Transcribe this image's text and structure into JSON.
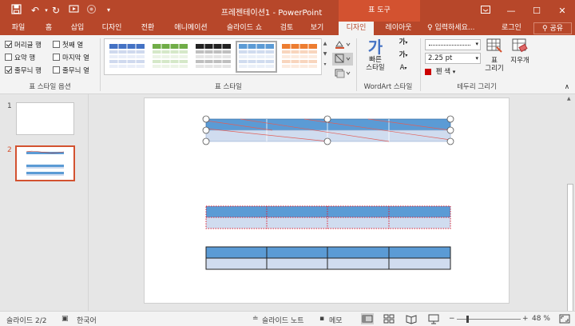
{
  "titlebar": {
    "title": "프레젠테이션1 - PowerPoint",
    "context_tab": "표 도구",
    "quick_access": [
      "save-icon",
      "undo-icon",
      "redo-icon",
      "start-from-beginning-icon",
      "touch-mode-icon"
    ],
    "window_buttons": [
      "ribbon-display-icon",
      "minimize-icon",
      "maximize-icon",
      "close-icon"
    ]
  },
  "tabs": [
    "파일",
    "홈",
    "삽입",
    "디자인",
    "전환",
    "애니메이션",
    "슬라이드 쇼",
    "검토",
    "보기",
    "디자인",
    "레이아웃"
  ],
  "active_tab_index": 9,
  "tellme": "입력하세요...",
  "login": "로그인",
  "share": "공유",
  "ribbon": {
    "style_options": {
      "label": "표 스타일 옵션",
      "items": [
        {
          "label": "머리글 행",
          "checked": true
        },
        {
          "label": "첫째 열",
          "checked": false
        },
        {
          "label": "요약 행",
          "checked": false
        },
        {
          "label": "마지막 열",
          "checked": false
        },
        {
          "label": "줄무늬 행",
          "checked": true
        },
        {
          "label": "줄무늬 열",
          "checked": false
        }
      ]
    },
    "table_styles": {
      "label": "표 스타일",
      "colors": [
        "#4472c4",
        "#70ad47",
        "#222222",
        "#5b9bd5",
        "#ed7d31"
      ],
      "selected_index": 3
    },
    "wordart": {
      "label": "WordArt 스타일",
      "quick_styles": "빠른\n스타일",
      "quick_styles_line1": "빠른",
      "quick_styles_line2": "스타일"
    },
    "borders": {
      "label": "테두리 그리기",
      "pen_weight": "2.25 pt",
      "pen_color": "펜 색",
      "draw_table_line1": "표",
      "draw_table_line2": "그리기",
      "eraser": "지우개"
    }
  },
  "slides": [
    {
      "number": "1"
    },
    {
      "number": "2"
    }
  ],
  "statusbar": {
    "slide_info": "슬라이드 2/2",
    "language": "한국어",
    "notes": "슬라이드 노트",
    "comments": "메모",
    "zoom": "48 %"
  },
  "colors": {
    "accent": "#b7472a",
    "context": "#d35230",
    "table_header": "#5b9bd5",
    "table_band": "#d0dcef"
  }
}
